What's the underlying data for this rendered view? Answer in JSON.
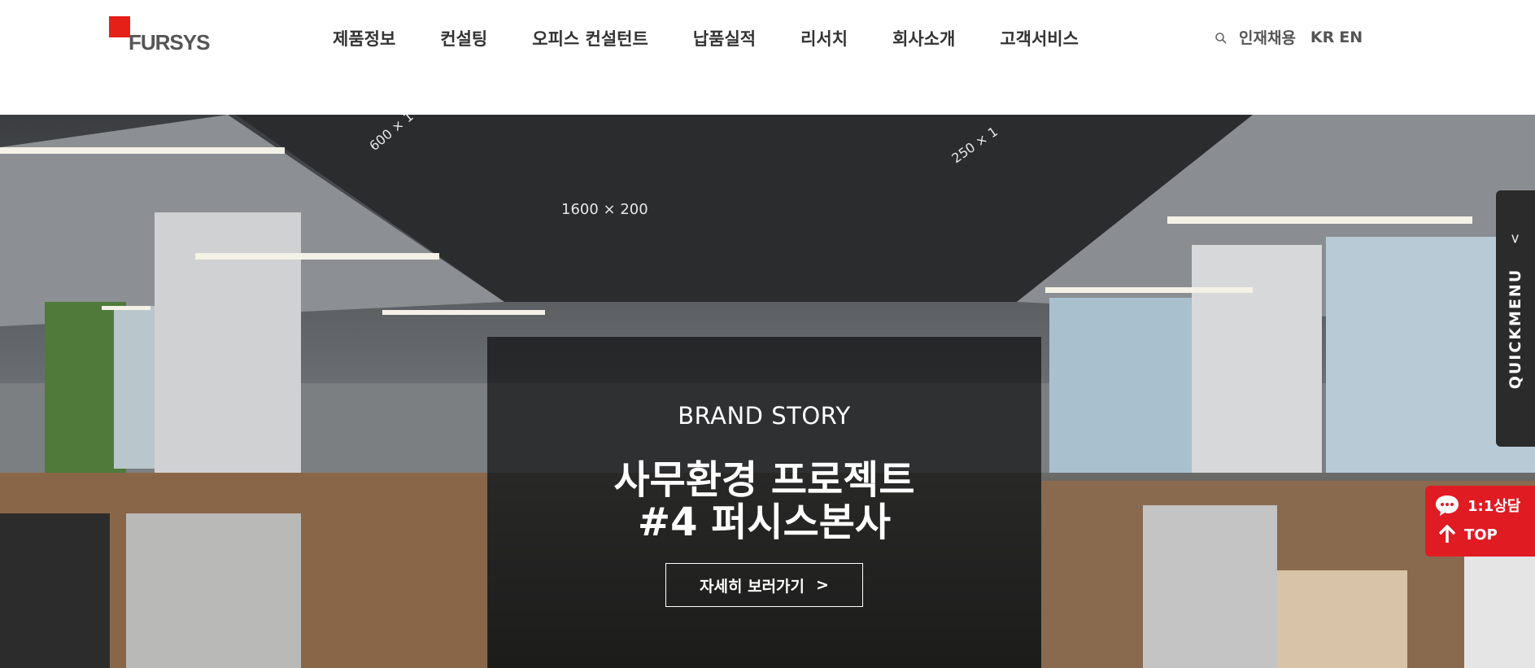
{
  "brand": {
    "logo_text": "FURSYS",
    "accent": "#e52019"
  },
  "nav": {
    "items": [
      {
        "label": "제품정보"
      },
      {
        "label": "컨설팅"
      },
      {
        "label": "오피스 컨설턴트"
      },
      {
        "label": "납품실적"
      },
      {
        "label": "리서치"
      },
      {
        "label": "회사소개"
      },
      {
        "label": "고객서비스"
      }
    ]
  },
  "util": {
    "search_icon": "search-icon",
    "recruit": "인재채용",
    "lang_kr": "KR",
    "lang_en": "EN"
  },
  "hero": {
    "eyebrow": "BRAND STORY",
    "title_line1": "사무환경 프로젝트",
    "title_line2": "#4 퍼시스본사",
    "button_label": "자세히 보러가기",
    "button_icon": ">",
    "ceiling_signs": [
      "1600 × 200",
      "250 × 1",
      "600 × 1"
    ]
  },
  "quick": {
    "label": "QUICKMENU",
    "arrow": ">",
    "chat_label": "1:1상담",
    "top_label": "TOP",
    "chat_color": "#e11b22"
  }
}
